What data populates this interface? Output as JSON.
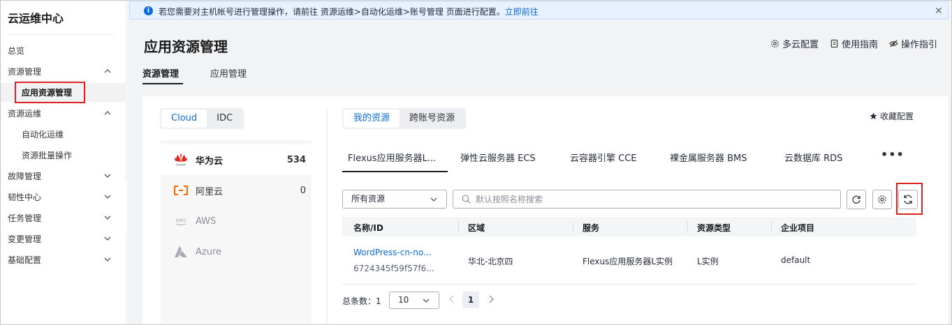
{
  "sidebar": {
    "title": "云运维中心",
    "items": [
      {
        "label": "总览"
      },
      {
        "label": "资源管理",
        "expanded": true
      },
      {
        "label": "应用资源管理",
        "active": true
      },
      {
        "label": "资源运维",
        "expanded": true
      },
      {
        "label": "自动化运维"
      },
      {
        "label": "资源批量操作"
      },
      {
        "label": "故障管理"
      },
      {
        "label": "韧性中心"
      },
      {
        "label": "任务管理"
      },
      {
        "label": "变更管理"
      },
      {
        "label": "基础配置"
      }
    ]
  },
  "banner": {
    "text": "若您需要对主机帐号进行管理操作，请前往 资源运维>自动化运维>账号管理 页面进行配置。",
    "link": "立即前往",
    "close": "✕"
  },
  "header": {
    "title": "应用资源管理",
    "links": [
      "多云配置",
      "使用指南",
      "操作指引"
    ],
    "tabs": [
      "资源管理",
      "应用管理"
    ]
  },
  "cloud_switch": [
    "Cloud",
    "IDC"
  ],
  "clouds": [
    {
      "name": "华为云",
      "count": "534"
    },
    {
      "name": "阿里云",
      "count": "0"
    },
    {
      "name": "AWS",
      "count": ""
    },
    {
      "name": "Azure",
      "count": ""
    }
  ],
  "resource_switch": [
    "我的资源",
    "跨账号资源"
  ],
  "favorite": "收藏配置",
  "service_tabs": [
    "Flexus应用服务器L...",
    "弹性云服务器 ECS",
    "云容器引擎 CCE",
    "裸金属服务器 BMS",
    "云数据库 RDS"
  ],
  "more": "•••",
  "filter": {
    "select_value": "所有资源",
    "search_placeholder": "默认按照名称搜索"
  },
  "table": {
    "columns": [
      "名称/ID",
      "区域",
      "服务",
      "资源类型",
      "企业项目"
    ],
    "rows": [
      {
        "name": "WordPress-cn-no...",
        "id": "6724345f59f57f6...",
        "region": "华北-北京四",
        "service": "Flexus应用服务器L实例",
        "type": "L实例",
        "project": "default"
      }
    ]
  },
  "pager": {
    "total_label": "总条数：",
    "total": "1",
    "page_size": "10",
    "current_page": "1"
  },
  "colors": {
    "accent": "#0b6bdc",
    "highlight": "#e02020"
  }
}
